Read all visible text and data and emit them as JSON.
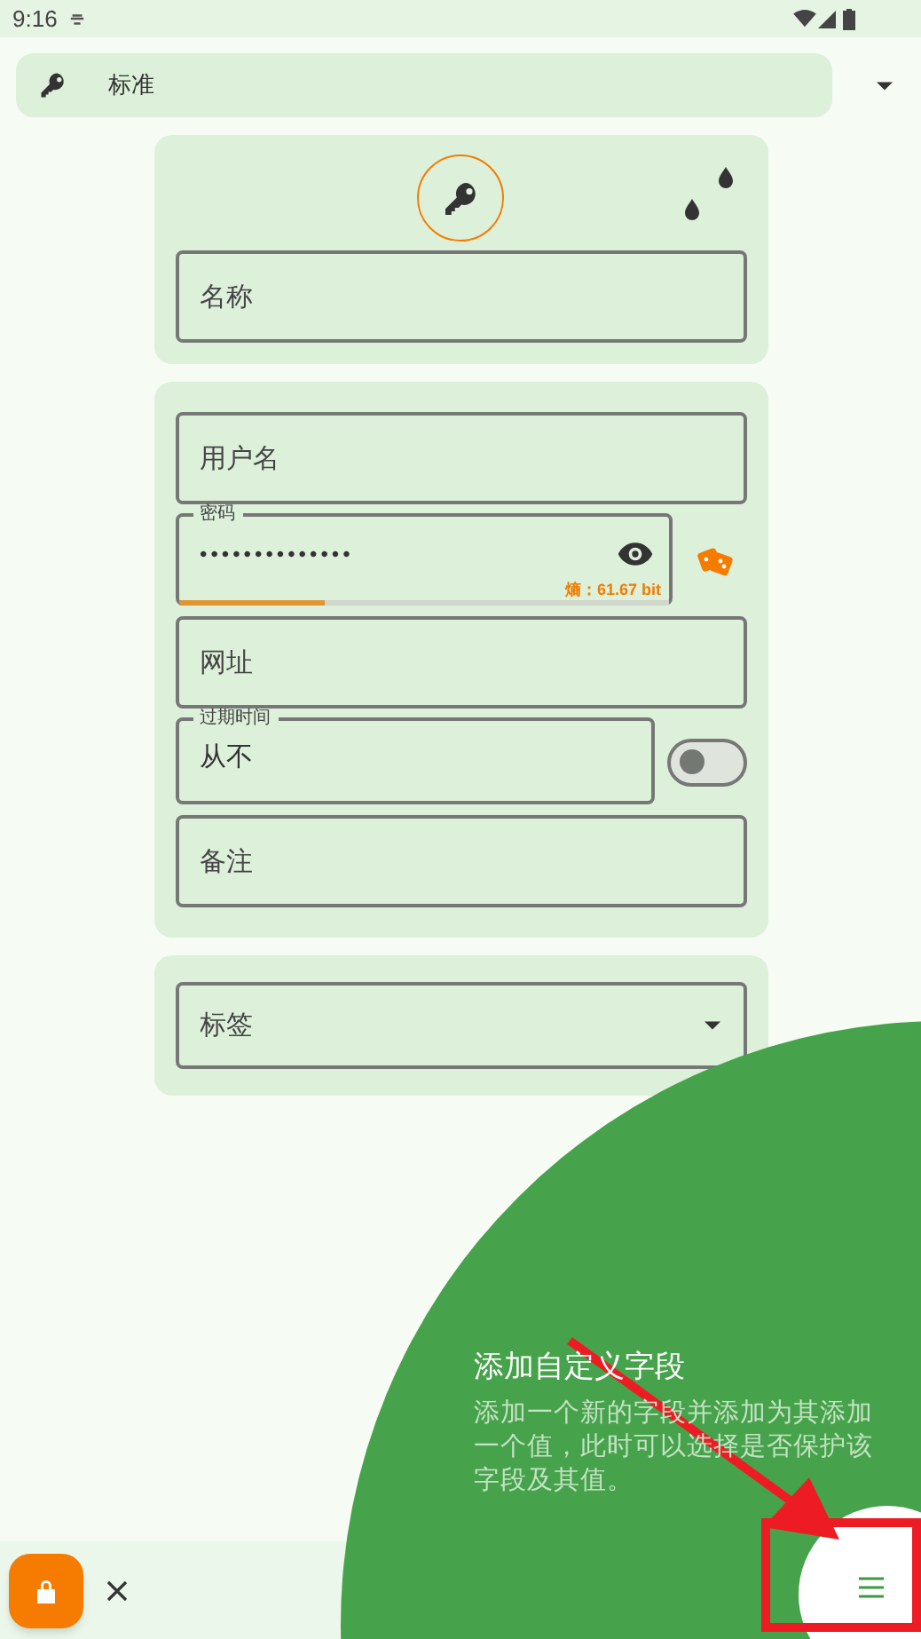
{
  "status_bar": {
    "time": "9:16"
  },
  "entry_type": {
    "label": "标准"
  },
  "header_card": {
    "name_field": {
      "placeholder": "名称"
    }
  },
  "fields": [
    {
      "kind": "text",
      "placeholder": "用户名"
    },
    {
      "kind": "password",
      "label": "密码",
      "value": "••••••••••••••",
      "entropy": "熵：61.67 bit",
      "level": 0.3
    },
    {
      "kind": "text",
      "placeholder": "网址"
    },
    {
      "kind": "expiry",
      "label": "过期时间",
      "value": "从不",
      "on": false
    },
    {
      "kind": "text",
      "placeholder": "备注"
    }
  ],
  "tags_field": {
    "placeholder": "标签"
  },
  "tutorial": {
    "title": "添加自定义字段",
    "description": "添加一个新的字段并添加为其添加一个值，此时可以选择是否保护该字段及其值。"
  }
}
